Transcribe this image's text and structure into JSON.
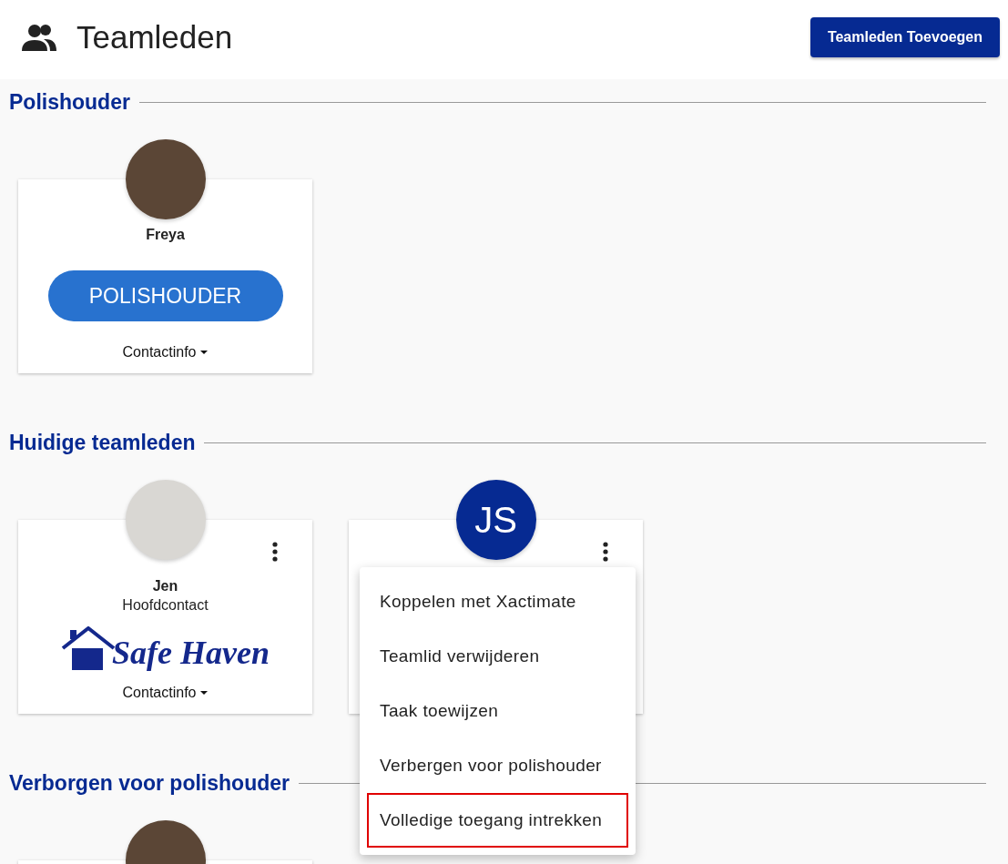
{
  "header": {
    "title": "Teamleden",
    "add_button": "Teamleden Toevoegen"
  },
  "sections": [
    {
      "title": "Polishouder",
      "cards": [
        {
          "avatar": {
            "kind": "photo"
          },
          "name": "Freya",
          "role_badge": "POLISHOUDER",
          "contact": "Contactinfo"
        }
      ]
    },
    {
      "title": "Huidige teamleden",
      "cards": [
        {
          "avatar": {
            "kind": "sketch"
          },
          "name": "Jen",
          "subtitle": "Hoofdcontact",
          "logo": "Safe Haven",
          "contact": "Contactinfo",
          "has_menu": true
        },
        {
          "avatar": {
            "kind": "initials",
            "initials": "JS"
          },
          "has_menu": true,
          "menu": [
            {
              "label": "Koppelen met Xactimate",
              "highlighted": false
            },
            {
              "label": "Teamlid verwijderen",
              "highlighted": false
            },
            {
              "label": "Taak toewijzen",
              "highlighted": false
            },
            {
              "label": "Verbergen voor polishouder",
              "highlighted": false
            },
            {
              "label": "Volledige toegang intrekken",
              "highlighted": true
            }
          ]
        }
      ]
    },
    {
      "title": "Verborgen voor polishouder",
      "cards": [
        {
          "avatar": {
            "kind": "photo"
          }
        }
      ]
    }
  ]
}
